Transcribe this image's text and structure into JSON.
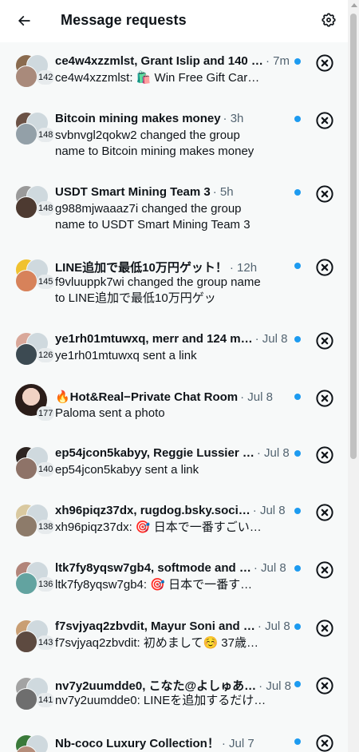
{
  "header": {
    "title": "Message requests",
    "back_icon": "arrow-left-icon",
    "settings_icon": "gear-icon"
  },
  "colors": {
    "unread": "#1d9bf0",
    "muted": "#536471",
    "background": "#f7f9f9"
  },
  "requests": [
    {
      "name": "ce4w4xzzmlst, Grant Islip and 140 …",
      "time": "· 7m",
      "count": "142",
      "preview": "ce4w4xzzmlst: 🛍️ Win Free Gift Car…"
    },
    {
      "name": "Bitcoin mining makes money",
      "time": "· 3h",
      "count": "148",
      "preview": "svbnvgl2qokw2 changed the group name to Bitcoin mining makes money"
    },
    {
      "name": "USDT Smart Mining Team 3",
      "time": "· 5h",
      "count": "148",
      "preview": "g988mjwaaaz7i changed the group name to USDT Smart Mining Team 3"
    },
    {
      "name": "LINE追加で最低10万円ゲット！",
      "time": "· 12h",
      "count": "145",
      "preview": "f9vluuppk7wi changed the group name to LINE追加で最低10万円ゲッ"
    },
    {
      "name": "ye1rh01mtuwxq, merr and 124 m…",
      "time": "· Jul 8",
      "count": "126",
      "preview": "ye1rh01mtuwxq sent a link"
    },
    {
      "name": "🔥Hot&Real−Private Chat Room",
      "time": "· Jul 8",
      "count": "177",
      "preview": "Paloma sent a photo"
    },
    {
      "name": "ep54jcon5kabyy, Reggie Lussier …",
      "time": "· Jul 8",
      "count": "140",
      "preview": "ep54jcon5kabyy sent a link"
    },
    {
      "name": "xh96piqz37dx, rugdog.bsky.soci…",
      "time": "· Jul 8",
      "count": "138",
      "preview": "xh96piqz37dx: 🎯 日本で一番すごい…"
    },
    {
      "name": "ltk7fy8yqsw7gb4, softmode and …",
      "time": "· Jul 8",
      "count": "136",
      "preview": "ltk7fy8yqsw7gb4: 🎯 日本で一番す…"
    },
    {
      "name": "f7svjyaq2zbvdit, Mayur Soni and …",
      "time": "· Jul 8",
      "count": "143",
      "preview": "f7svjyaq2zbvdit: 初めまして☺️ 37歳…"
    },
    {
      "name": "nv7y2uumdde0, こなた@よしゅあ…",
      "time": "· Jul 8",
      "count": "141",
      "preview": "nv7y2uumdde0: LINEを追加するだけ…"
    },
    {
      "name": "Nb-coco Luxury Collection！",
      "time": "· Jul 7",
      "count": "",
      "preview": ""
    }
  ]
}
